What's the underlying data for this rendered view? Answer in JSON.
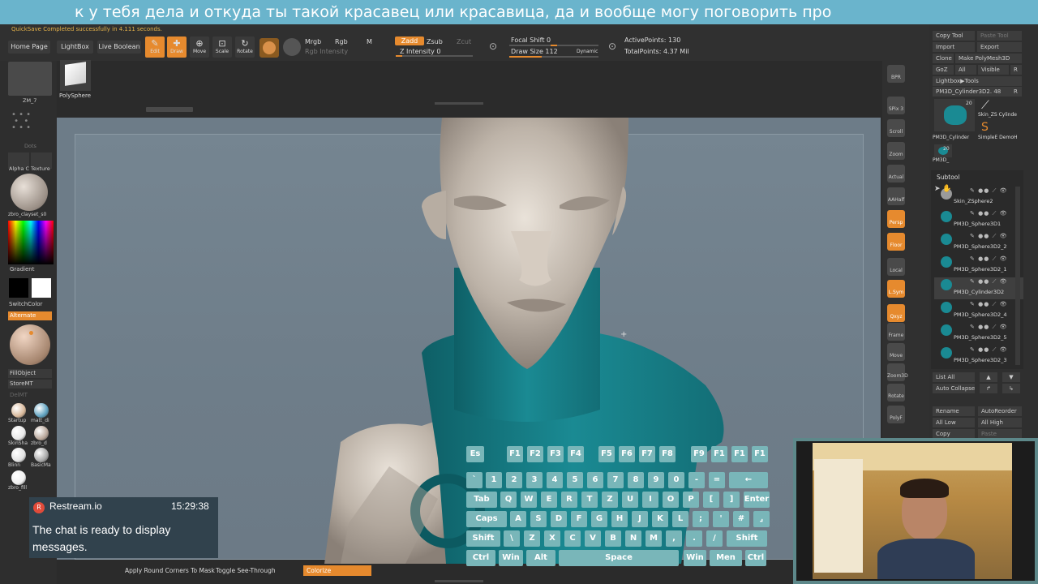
{
  "ticker": {
    "text": "к у тебя дела и откуда ты такой красавец или красавица, да и вообще могу поговорить про"
  },
  "topbar": {
    "status": "QuickSave Completed successfully in 4.111 seconds.",
    "home_page": "Home Page",
    "lightbox": "LightBox",
    "live_boolean": "Live Boolean",
    "tools": [
      {
        "icon": "edit-icon",
        "label": "Edit",
        "glyph": "✎"
      },
      {
        "icon": "draw-icon",
        "label": "Draw",
        "glyph": "✚"
      },
      {
        "icon": "move-icon",
        "label": "Move",
        "glyph": "⊕"
      },
      {
        "icon": "scale-icon",
        "label": "Scale",
        "glyph": "⊡"
      },
      {
        "icon": "rotate-icon",
        "label": "Rotate",
        "glyph": "↻"
      }
    ],
    "mrgb": "Mrgb",
    "rgb": "Rgb",
    "m": "M",
    "rgb_intensity": "Rgb Intensity",
    "zadd": "Zadd",
    "zsub": "Zsub",
    "zcut": "Zcut",
    "z_intensity": "Z Intensity 0",
    "focal_shift": "Focal Shift 0",
    "draw_size": "Draw Size 112",
    "dynamic": "Dynamic",
    "active_points": "ActivePoints: 130",
    "total_points": "TotalPoints: 4.37 Mil"
  },
  "leftpanel": {
    "tool_thumb_label": "ZM_7",
    "polysphere_label": "PolySphere",
    "dots_label": "Dots",
    "alpha_label": "Alpha C",
    "texture_label": "Texture",
    "material_label": "zbro_clayset_s0",
    "gradient": "Gradient",
    "switch_color": "SwitchColor",
    "alternate": "Alternate",
    "fill_object": "FillObject",
    "store_mt": "StoreMT",
    "del_mt": "DelMT",
    "materials": [
      {
        "label": "Startup",
        "color": "#d8b89a"
      },
      {
        "label": "matt_di",
        "color": "#5fa2c0"
      },
      {
        "label": "SkinSha",
        "color": "#e8e8e8"
      },
      {
        "label": "zbro_d",
        "color": "#b9a79a"
      },
      {
        "label": "Blinn",
        "color": "#e2e2e2"
      },
      {
        "label": "BasicMa",
        "color": "#a8a8a8"
      },
      {
        "label": "zbro_fill",
        "color": "#f0f0f0"
      }
    ]
  },
  "rightshelf": {
    "items": [
      {
        "icon": "bpr-icon",
        "label": "BPR"
      },
      {
        "icon": "spix-icon",
        "label": "SPix 3"
      },
      {
        "icon": "scroll-icon",
        "label": "Scroll"
      },
      {
        "icon": "zoom-icon",
        "label": "Zoom"
      },
      {
        "icon": "actual-icon",
        "label": "Actual"
      },
      {
        "icon": "aahalf-icon",
        "label": "AAHalf"
      },
      {
        "icon": "persp-icon",
        "label": "Persp"
      },
      {
        "icon": "floor-icon",
        "label": "Floor"
      },
      {
        "icon": "local-icon",
        "label": "Local"
      },
      {
        "icon": "lsym-icon",
        "label": "L.Sym"
      },
      {
        "icon": "xyz-icon",
        "label": "Qxyz"
      },
      {
        "icon": "frame-icon",
        "label": "Frame"
      },
      {
        "icon": "move-view-icon",
        "label": "Move"
      },
      {
        "icon": "zoom3d-icon",
        "label": "Zoom3D"
      },
      {
        "icon": "rotate-view-icon",
        "label": "Rotate"
      },
      {
        "icon": "polyf-icon",
        "label": "PolyF"
      }
    ]
  },
  "rpanel": {
    "row1": [
      "Copy Tool",
      "Paste Tool"
    ],
    "row2": [
      "Import",
      "Export"
    ],
    "row3": [
      "Clone",
      "Make PolyMesh3D"
    ],
    "row4": [
      "GoZ",
      "All",
      "Visible",
      "R"
    ],
    "lightbox_tools": "Lightbox▶Tools",
    "current_tool": "PM3D_Cylinder3D2. 48",
    "r": "R",
    "thumbs": [
      {
        "label": "PM3D_Cylinder",
        "count": "20"
      },
      {
        "label": "Skin_ZS Cylinde",
        "count": ""
      },
      {
        "label": "SimpleE DemoH",
        "count": ""
      },
      {
        "label": "PM3D_",
        "count": "20"
      }
    ],
    "subtool_title": "Subtool",
    "subtools": [
      {
        "name": "Skin_ZSphere2",
        "color": "#9a9a9a"
      },
      {
        "name": "PM3D_Sphere3D1",
        "color": "#1a8a93"
      },
      {
        "name": "PM3D_Sphere3D2_2",
        "color": "#1a8a93"
      },
      {
        "name": "PM3D_Sphere3D2_1",
        "color": "#1a8a93"
      },
      {
        "name": "PM3D_Cylinder3D2",
        "color": "#1a8a93"
      },
      {
        "name": "PM3D_Sphere3D2_4",
        "color": "#1a8a93"
      },
      {
        "name": "PM3D_Sphere3D2_5",
        "color": "#1a8a93"
      },
      {
        "name": "PM3D_Sphere3D2_3",
        "color": "#1a8a93"
      }
    ],
    "list_all": "List All",
    "auto_collapse": "Auto Collapse",
    "rename": "Rename",
    "auto_reorder": "AutoReorder",
    "all_low": "All Low",
    "all_high": "All High",
    "copy": "Copy",
    "paste": "Paste"
  },
  "bottombar": {
    "apply_round": "Apply Round Corners To Mask",
    "toggle_see_through": "Toggle See-Through",
    "colorize": "Colorize"
  },
  "chat": {
    "app": "Restream.io",
    "time": "15:29:38",
    "message": "The chat is ready to display messages."
  },
  "keyboard": {
    "rows": [
      [
        "Es",
        "F1",
        "F2",
        "F3",
        "F4",
        "F5",
        "F6",
        "F7",
        "F8",
        "F9",
        "F1",
        "F1",
        "F1"
      ],
      [
        "`",
        "1",
        "2",
        "3",
        "4",
        "5",
        "6",
        "7",
        "8",
        "9",
        "0",
        "-",
        "=",
        "←"
      ],
      [
        "Tab",
        "Q",
        "W",
        "E",
        "R",
        "T",
        "Z",
        "U",
        "I",
        "O",
        "P",
        "[",
        "]",
        "Enter"
      ],
      [
        "Caps",
        "A",
        "S",
        "D",
        "F",
        "G",
        "H",
        "J",
        "K",
        "L",
        ";",
        "'",
        "#",
        "⌟"
      ],
      [
        "Shift",
        "\\",
        "Z",
        "X",
        "C",
        "V",
        "B",
        "N",
        "M",
        ",",
        ".",
        "/",
        "Shift"
      ],
      [
        "Ctrl",
        "Win",
        "Alt",
        "Space",
        "Win",
        "Men",
        "Ctrl"
      ]
    ]
  },
  "colors": {
    "accent": "#e68a2e",
    "teal": "#1a8a93",
    "key": "#79b6b9",
    "viewport": "#6e7d89"
  }
}
